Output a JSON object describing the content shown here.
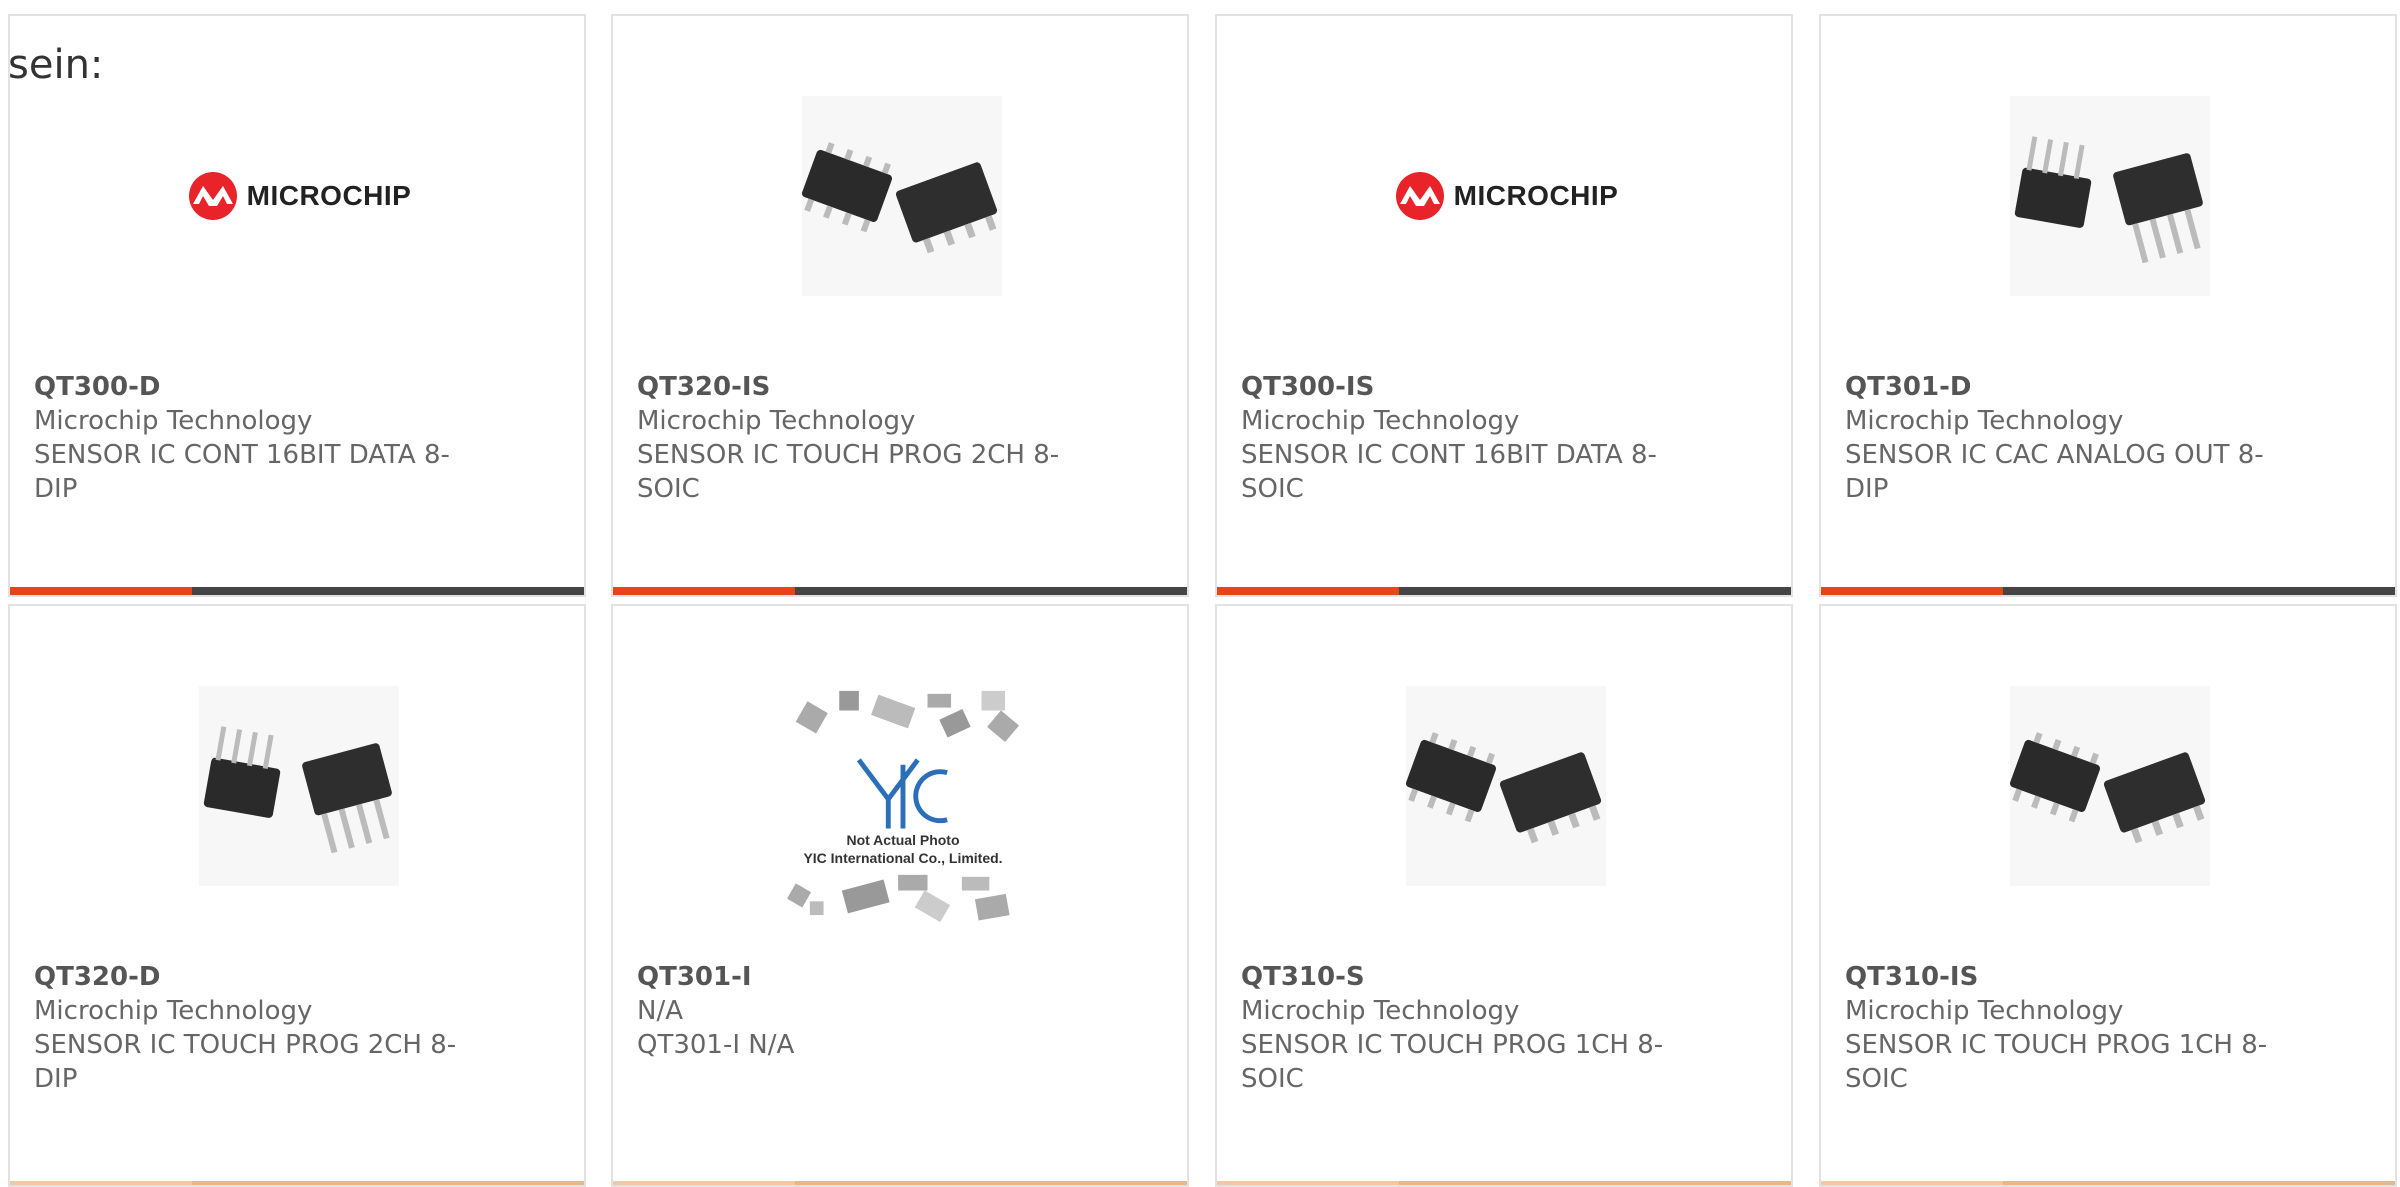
{
  "intro_text": "sein:",
  "logo": {
    "wordmark": "MICROCHIP"
  },
  "placeholder": {
    "line1": "Not Actual Photo",
    "line2": "YIC International Co., Limited.",
    "mark": "YIC"
  },
  "colors": {
    "accent": "#e8441a",
    "bar_dark": "#444444",
    "border": "#e2e2e2"
  },
  "products": [
    {
      "part": "QT300-D",
      "manufacturer": "Microchip Technology",
      "desc1": "SENSOR IC CONT 16BIT DATA 8-",
      "desc2": "DIP",
      "image": "microchip-logo"
    },
    {
      "part": "QT320-IS",
      "manufacturer": "Microchip Technology",
      "desc1": "SENSOR IC TOUCH PROG 2CH 8-",
      "desc2": "SOIC",
      "image": "soic-chip"
    },
    {
      "part": "QT300-IS",
      "manufacturer": "Microchip Technology",
      "desc1": "SENSOR IC CONT 16BIT DATA 8-",
      "desc2": "SOIC",
      "image": "microchip-logo"
    },
    {
      "part": "QT301-D",
      "manufacturer": "Microchip Technology",
      "desc1": "SENSOR IC CAC ANALOG OUT 8-",
      "desc2": "DIP",
      "image": "dip-chip"
    },
    {
      "part": "QT320-D",
      "manufacturer": "Microchip Technology",
      "desc1": "SENSOR IC TOUCH PROG 2CH 8-",
      "desc2": "DIP",
      "image": "dip-chip"
    },
    {
      "part": "QT301-I",
      "manufacturer": "N/A",
      "desc1": "QT301-I N/A",
      "desc2": "",
      "image": "yic-placeholder"
    },
    {
      "part": "QT310-S",
      "manufacturer": "Microchip Technology",
      "desc1": "SENSOR IC TOUCH PROG 1CH 8-",
      "desc2": "SOIC",
      "image": "soic-chip"
    },
    {
      "part": "QT310-IS",
      "manufacturer": "Microchip Technology",
      "desc1": "SENSOR IC TOUCH PROG 1CH 8-",
      "desc2": "SOIC",
      "image": "soic-chip"
    }
  ]
}
